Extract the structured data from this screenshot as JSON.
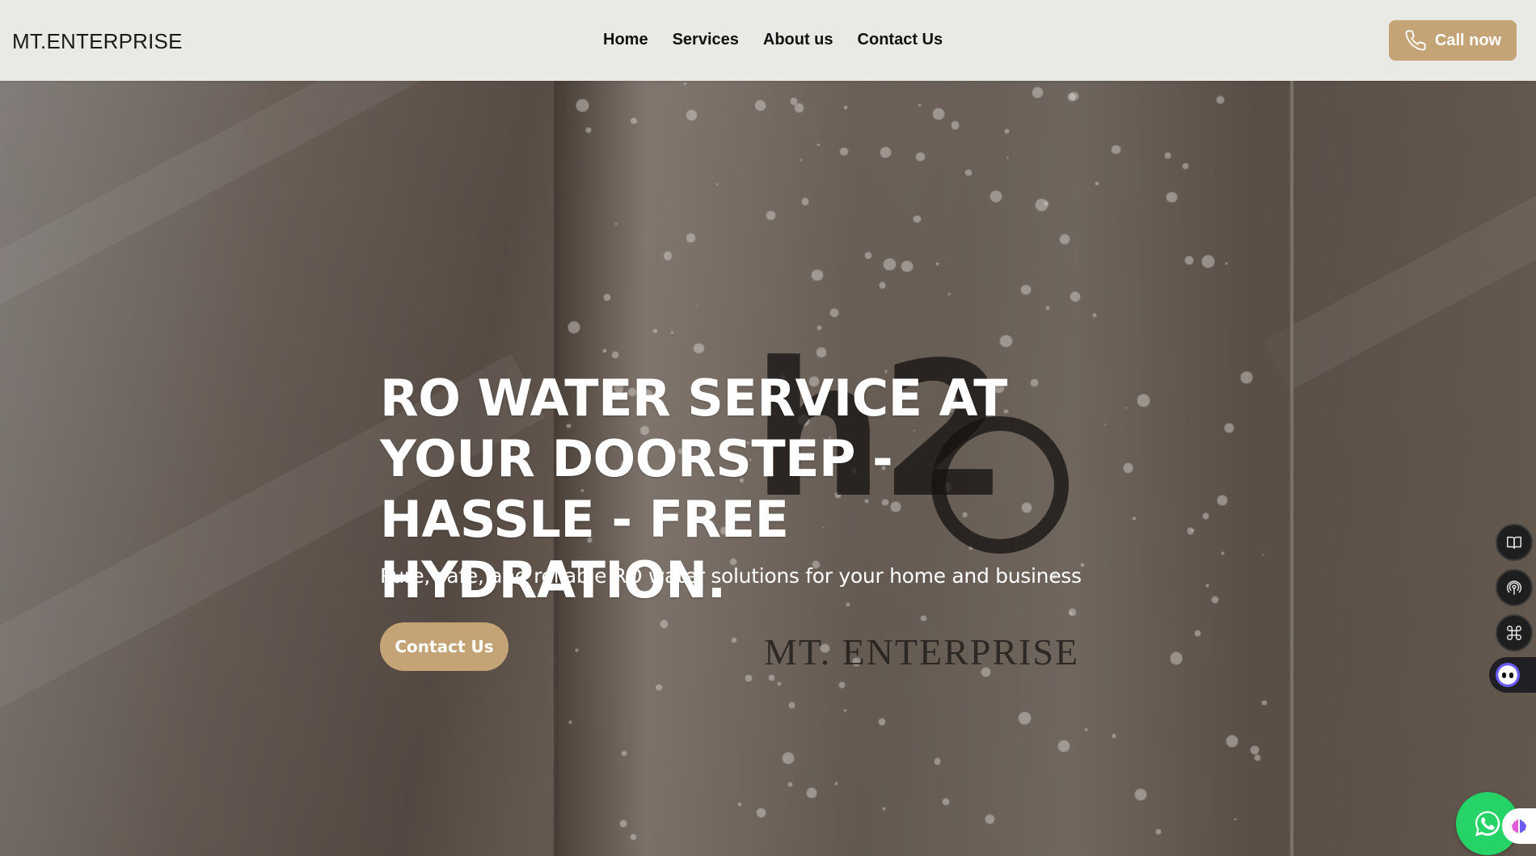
{
  "header": {
    "brand": "MT.ENTERPRISE",
    "nav": [
      {
        "label": "Home"
      },
      {
        "label": "Services"
      },
      {
        "label": "About us"
      },
      {
        "label": "Contact Us"
      }
    ],
    "call_button": {
      "label": "Call now",
      "icon": "phone-icon"
    }
  },
  "hero": {
    "title": "RO WATER SERVICE AT YOUR DOORSTEP - HASSLE - FREE HYDRATION.",
    "subtitle": "Pure, safe, and reliable RO water solutions for your home and business",
    "cta_label": "Contact Us",
    "image_text": {
      "logo_mark": "h2O",
      "bottle_brand": "MT. ENTERPRISE"
    }
  },
  "floating": {
    "side_tools": [
      "book-icon",
      "podcast-icon",
      "command-icon"
    ],
    "assistant_icon": "assistant-face-icon",
    "whatsapp_icon": "whatsapp-icon",
    "brain_icon": "brain-icon"
  },
  "colors": {
    "accent": "#c4a376",
    "navbar_bg": "#e9e9e5",
    "whatsapp": "#25d366"
  }
}
